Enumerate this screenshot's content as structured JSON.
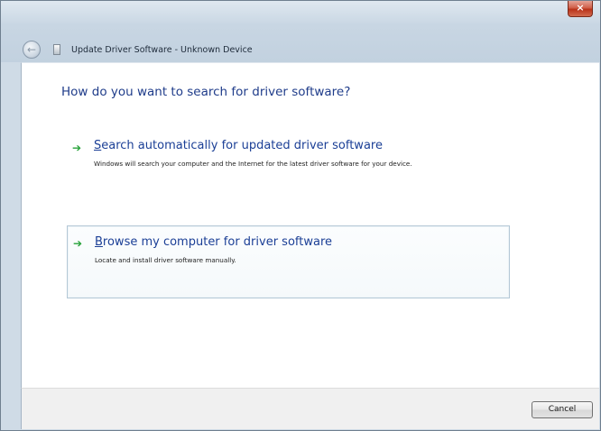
{
  "window": {
    "title": "Update Driver Software - Unknown Device",
    "close_label": "×"
  },
  "nav": {
    "back_icon": "back-arrow-icon",
    "back_glyph": "←",
    "device_icon": "device-icon"
  },
  "main": {
    "heading": "How do you want to search for driver software?",
    "options": [
      {
        "icon": "green-arrow-icon",
        "arrow_glyph": "➔",
        "title_first": "S",
        "title_rest": "earch automatically for updated driver software",
        "description": "Windows will search your computer and the Internet for the latest driver software for your device."
      },
      {
        "icon": "green-arrow-icon",
        "arrow_glyph": "➔",
        "title_first": "B",
        "title_rest": "rowse my computer for driver software",
        "description": "Locate and install driver software manually."
      }
    ]
  },
  "footer": {
    "cancel_label": "Cancel"
  },
  "colors": {
    "heading": "#1f3c8a",
    "link": "#1b3f96",
    "arrow": "#27a23a",
    "close_button": "#c8422a",
    "frame": "#c8d6e3"
  }
}
